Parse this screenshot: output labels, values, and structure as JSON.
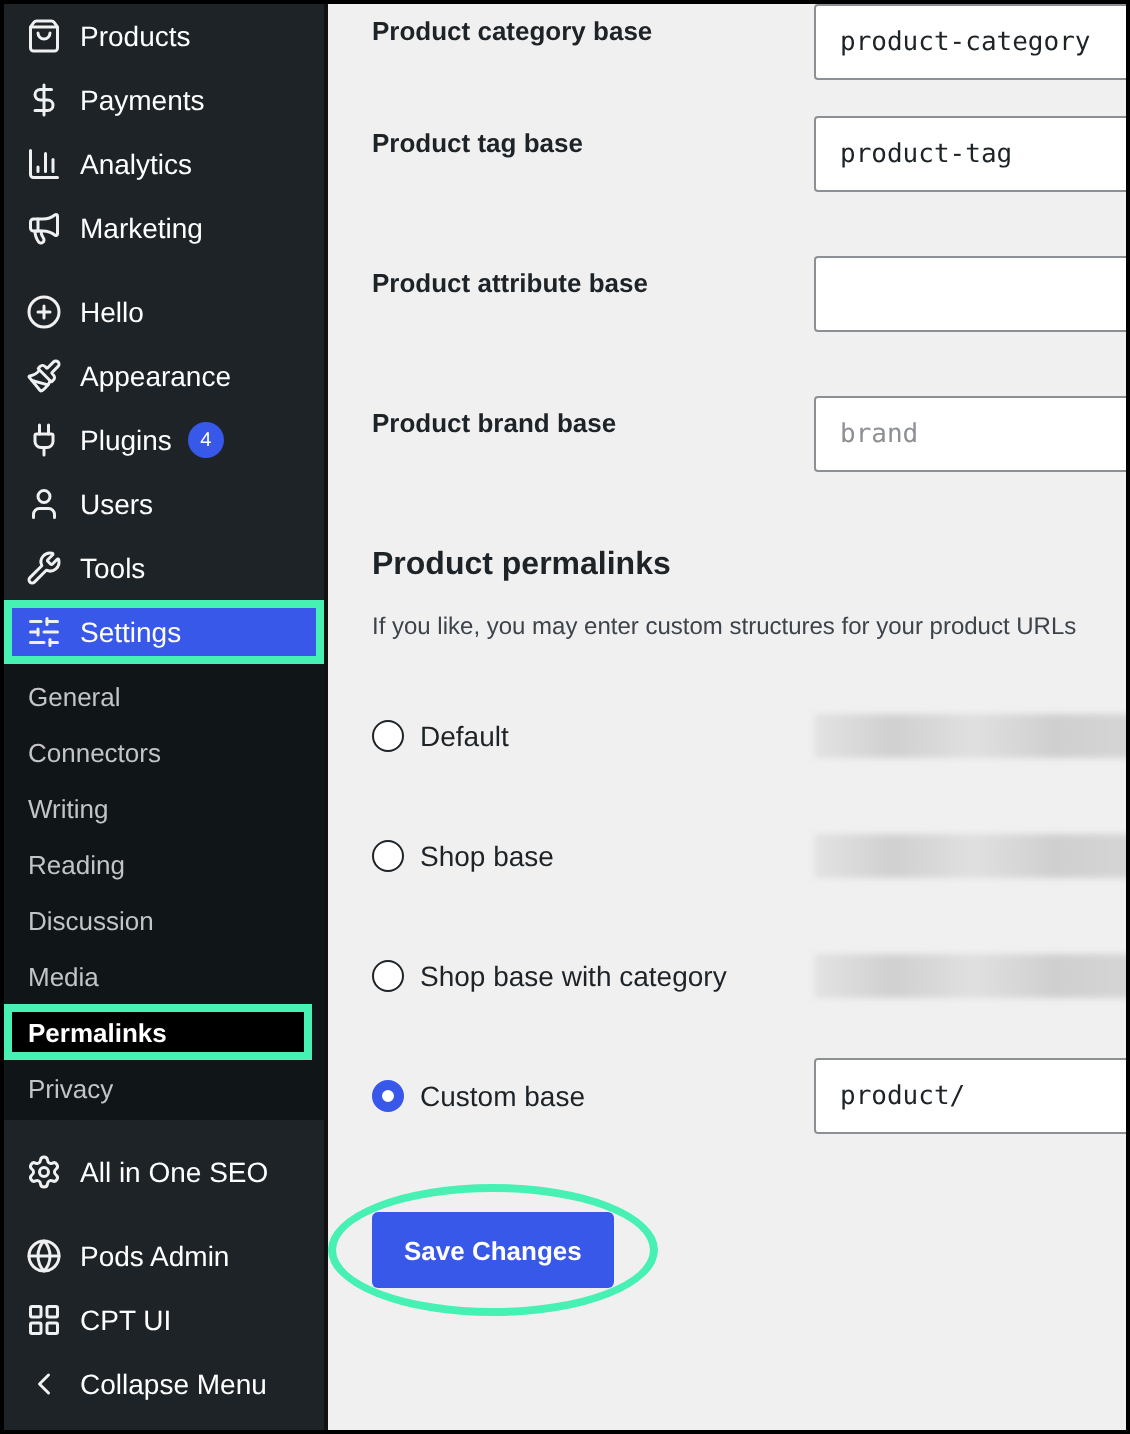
{
  "sidebar": {
    "groups": [
      {
        "items": [
          {
            "label": "Products",
            "selected": false,
            "highlighted": false
          },
          {
            "label": "Payments",
            "selected": false,
            "highlighted": false
          },
          {
            "label": "Analytics",
            "selected": false,
            "highlighted": false
          },
          {
            "label": "Marketing",
            "selected": false,
            "highlighted": false
          }
        ]
      },
      {
        "items": [
          {
            "label": "Hello",
            "selected": false,
            "highlighted": false
          },
          {
            "label": "Appearance",
            "selected": false,
            "highlighted": false
          },
          {
            "label": "Plugins",
            "badge": "4",
            "selected": false,
            "highlighted": false
          },
          {
            "label": "Users",
            "selected": false,
            "highlighted": false
          },
          {
            "label": "Tools",
            "selected": false,
            "highlighted": false
          },
          {
            "label": "Settings",
            "selected": true,
            "highlighted": true,
            "submenu": [
              {
                "label": "General",
                "selected": false,
                "highlighted": false
              },
              {
                "label": "Connectors",
                "selected": false,
                "highlighted": false
              },
              {
                "label": "Writing",
                "selected": false,
                "highlighted": false
              },
              {
                "label": "Reading",
                "selected": false,
                "highlighted": false
              },
              {
                "label": "Discussion",
                "selected": false,
                "highlighted": false
              },
              {
                "label": "Media",
                "selected": false,
                "highlighted": false
              },
              {
                "label": "Permalinks",
                "selected": true,
                "highlighted": true
              },
              {
                "label": "Privacy",
                "selected": false,
                "highlighted": false
              }
            ]
          }
        ]
      },
      {
        "items": [
          {
            "label": "All in One SEO",
            "selected": false,
            "highlighted": false
          }
        ]
      },
      {
        "items": [
          {
            "label": "Pods Admin",
            "selected": false,
            "highlighted": false
          },
          {
            "label": "CPT UI",
            "selected": false,
            "highlighted": false
          },
          {
            "label": "Collapse Menu",
            "selected": false,
            "highlighted": false
          }
        ]
      }
    ]
  },
  "fields": [
    {
      "label": "Product category base",
      "value": "product-category"
    },
    {
      "label": "Product tag base",
      "value": "product-tag"
    },
    {
      "label": "Product attribute base"
    },
    {
      "label": "Product brand base",
      "placeholder": "brand"
    }
  ],
  "section": {
    "title": "Product permalinks",
    "description": "If you like, you may enter custom structures for your product URLs"
  },
  "options": [
    {
      "label": "Default",
      "selected": false,
      "kind": "preview"
    },
    {
      "label": "Shop base",
      "selected": false,
      "kind": "preview"
    },
    {
      "label": "Shop base with category",
      "selected": false,
      "kind": "preview"
    },
    {
      "label": "Custom base",
      "selected": true,
      "kind": "input",
      "value": "product/"
    }
  ],
  "save_button": {
    "label": "Save Changes",
    "circled": true
  }
}
